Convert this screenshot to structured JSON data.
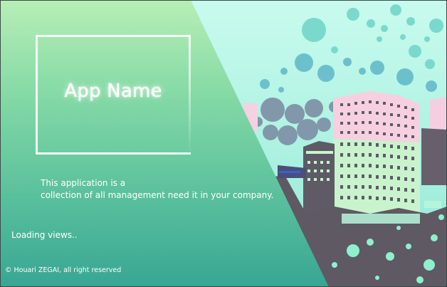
{
  "splash": {
    "app_name": "App Name",
    "description_line1": "This application is a",
    "description_line2": "collection of all management need it in your company.",
    "status": "Loading views..",
    "copyright": "© Houari ZEGAI, all right reserved"
  },
  "colors": {
    "panel_top": "#b4edb6",
    "panel_mid": "#6dcaa0",
    "panel_bottom": "#3aa996",
    "sky": "#b9f7e9",
    "building_pink": "#f7cde0",
    "building_shadow": "#5e5964",
    "splash_teal": "#5cc9bb"
  }
}
